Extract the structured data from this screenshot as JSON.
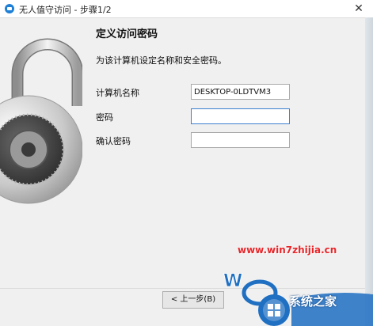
{
  "window": {
    "title": "无人值守访问 - 步骤1/2",
    "close_glyph": "✕"
  },
  "page": {
    "heading": "定义访问密码",
    "description": "为该计算机设定名称和安全密码。"
  },
  "form": {
    "computer_name_label": "计算机名称",
    "computer_name_value": "DESKTOP-0LDTVM3",
    "password_label": "密码",
    "password_value": "",
    "confirm_label": "确认密码",
    "confirm_value": ""
  },
  "buttons": {
    "back": "< 上一步(B)"
  },
  "watermark": {
    "url": "www.win7zhijia.cn",
    "logo_text": "系统之家"
  },
  "colors": {
    "accent": "#3c7fcf",
    "watermark_red": "#e8262a",
    "logo_blue": "#1f6fc2"
  },
  "icons": {
    "app": "teamviewer-icon",
    "lock": "padlock-icon"
  }
}
